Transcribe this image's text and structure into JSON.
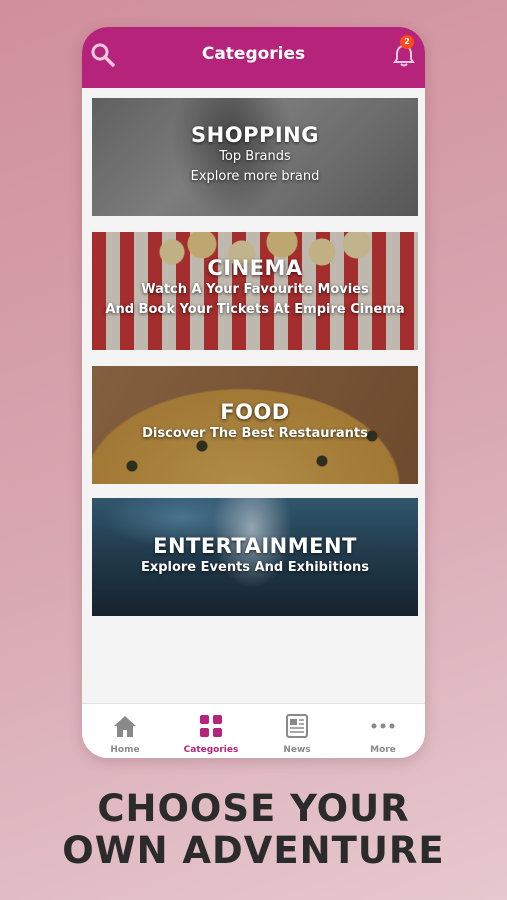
{
  "header": {
    "title": "Categories",
    "search_icon": "search-icon",
    "bell_icon": "bell-icon",
    "notification_count": "2"
  },
  "categories": [
    {
      "title": "SHOPPING",
      "lines": [
        "Top Brands",
        "Explore more brand"
      ]
    },
    {
      "title": "CINEMA",
      "lines": [
        "Watch A Your Favourite Movies",
        "And Book Your Tickets At Empire Cinema"
      ]
    },
    {
      "title": "FOOD",
      "lines": [
        "Discover The Best Restaurants"
      ]
    },
    {
      "title": "ENTERTAINMENT",
      "lines": [
        "Explore Events And Exhibitions"
      ]
    }
  ],
  "tabbar": {
    "tabs": [
      {
        "label": "Home",
        "icon": "home-icon",
        "active": false
      },
      {
        "label": "Categories",
        "icon": "grid-icon",
        "active": true
      },
      {
        "label": "News",
        "icon": "newspaper-icon",
        "active": false
      },
      {
        "label": "More",
        "icon": "more-dots-icon",
        "active": false
      }
    ]
  },
  "tagline": {
    "line1": "CHOOSE YOUR",
    "line2": "OWN ADVENTURE"
  },
  "colors": {
    "brand": "#b5247a",
    "badge": "#ff4a1c",
    "inactive_tab": "#8a8a8a",
    "background": "#d9a9b3"
  }
}
